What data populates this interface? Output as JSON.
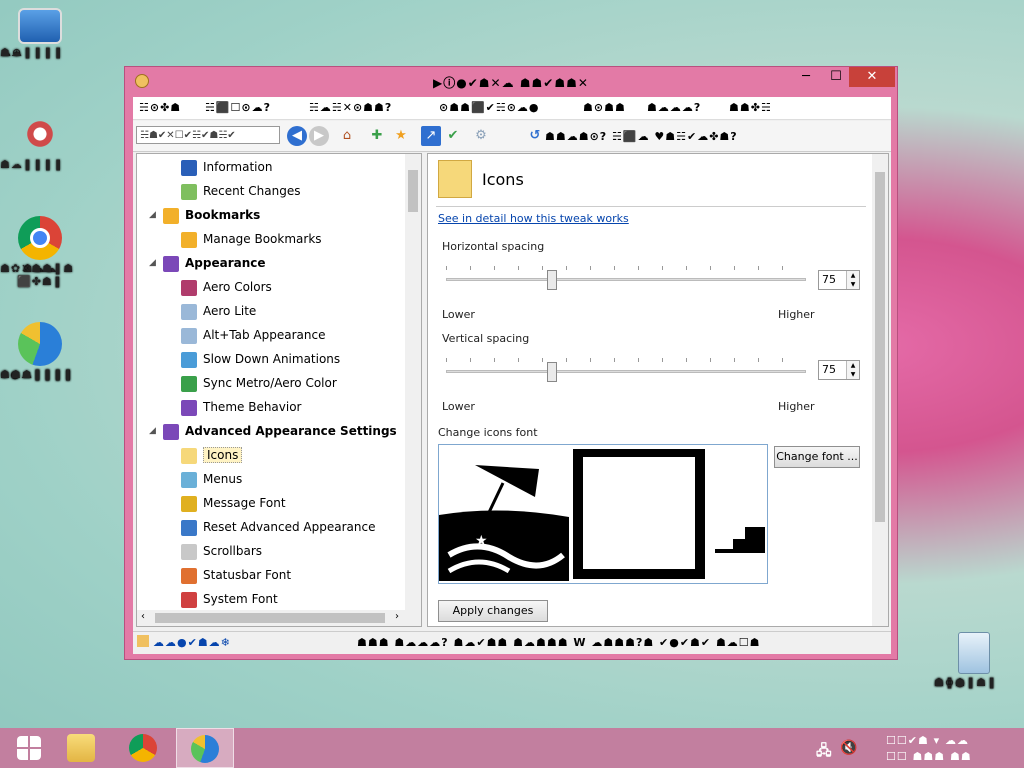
{
  "desktop": {
    "icons": [
      {
        "label1": "☁⊕",
        "label2": "☗☁❚❚❚❚"
      },
      {
        "label1": "☗☁❚❚❚❚",
        "label2": ""
      },
      {
        "label1": "☗☁☁⬛✤☗❚",
        "label2": "☗✿✕☗☗❚☗"
      },
      {
        "label1": "⊙●☁❚❚❚❚",
        "label2": "☗☗☗❚❚❚❚"
      },
      {
        "label1": "☗❚☗❚☗❚",
        "label2": "☗⊙●"
      }
    ]
  },
  "window": {
    "title": "▶ⓘ●✔☗✕☁ ☗☗✔☗☗✕",
    "controls": {
      "min": "─",
      "max": "☐",
      "close": "✕"
    }
  },
  "menubar": {
    "items": [
      "☵⊙✤☗",
      "☵⬛☐⊙☁?",
      "☵☁☵✕⊙☗☗?",
      "⊙☗☗⬛✔☵⊙☁●",
      "☗⊙☗☗",
      "☗☁☁☁?",
      "☗☗✤☵"
    ]
  },
  "toolbar": {
    "search_text": "☵☗✔✕☐✔☵✔☗☵✔",
    "right_text": "☗☗☁☗⊙? ☵⬛☁ ♥☗☵✔☁✤☗?"
  },
  "tree": {
    "items": [
      {
        "label": "Information",
        "type": "child",
        "color": "#2a5fb8"
      },
      {
        "label": "Recent Changes",
        "type": "child",
        "color": "#7fbf5f"
      },
      {
        "label": "Bookmarks",
        "type": "cat",
        "color": "#f2b02a"
      },
      {
        "label": "Manage Bookmarks",
        "type": "child",
        "color": "#f2b02a"
      },
      {
        "label": "Appearance",
        "type": "cat",
        "color": "#7b48b8"
      },
      {
        "label": "Aero Colors",
        "type": "child",
        "color": "#b03c6c"
      },
      {
        "label": "Aero Lite",
        "type": "child",
        "color": "#9ab8d8"
      },
      {
        "label": "Alt+Tab Appearance",
        "type": "child",
        "color": "#9ab8d8"
      },
      {
        "label": "Slow Down Animations",
        "type": "child",
        "color": "#4a9cd8"
      },
      {
        "label": "Sync Metro/Aero Color",
        "type": "child",
        "color": "#3aa04a"
      },
      {
        "label": "Theme Behavior",
        "type": "child",
        "color": "#7b48b8"
      },
      {
        "label": "Advanced Appearance Settings",
        "type": "cat",
        "color": "#7b48b8"
      },
      {
        "label": "Icons",
        "type": "child",
        "color": "#f6d87a",
        "selected": true
      },
      {
        "label": "Menus",
        "type": "child",
        "color": "#6ab0d8"
      },
      {
        "label": "Message Font",
        "type": "child",
        "color": "#e0b020"
      },
      {
        "label": "Reset Advanced Appearance",
        "type": "child",
        "color": "#3a78c8"
      },
      {
        "label": "Scrollbars",
        "type": "child",
        "color": "#c8c8c8"
      },
      {
        "label": "Statusbar Font",
        "type": "child",
        "color": "#e07030"
      },
      {
        "label": "System Font",
        "type": "child",
        "color": "#d04040"
      }
    ]
  },
  "panel": {
    "title": "Icons",
    "detail_link": "See in detail how this tweak works",
    "horizontal": {
      "label": "Horizontal spacing",
      "value": "75",
      "min_label": "Lower",
      "max_label": "Higher",
      "position": 0.28
    },
    "vertical": {
      "label": "Vertical spacing",
      "value": "75",
      "min_label": "Lower",
      "max_label": "Higher",
      "position": 0.28
    },
    "font_label": "Change icons font",
    "change_font_button": "Change font ...",
    "apply_button": "Apply changes"
  },
  "statusbar": {
    "left": "☁☁●✔☗☁❄",
    "right": "☗☗☗ ☗☁☁☁? ☗☁✔☗☗ ☗☁☗☗☗ W ☁☗☗☗?☗ ✔●✔☗✔ ☗☁☐☗"
  },
  "taskbar": {
    "tray_line1": "☐☐✔☗ ▾ ☁☁",
    "tray_line2": "☐☐ ☗☗☗ ☗☗"
  }
}
